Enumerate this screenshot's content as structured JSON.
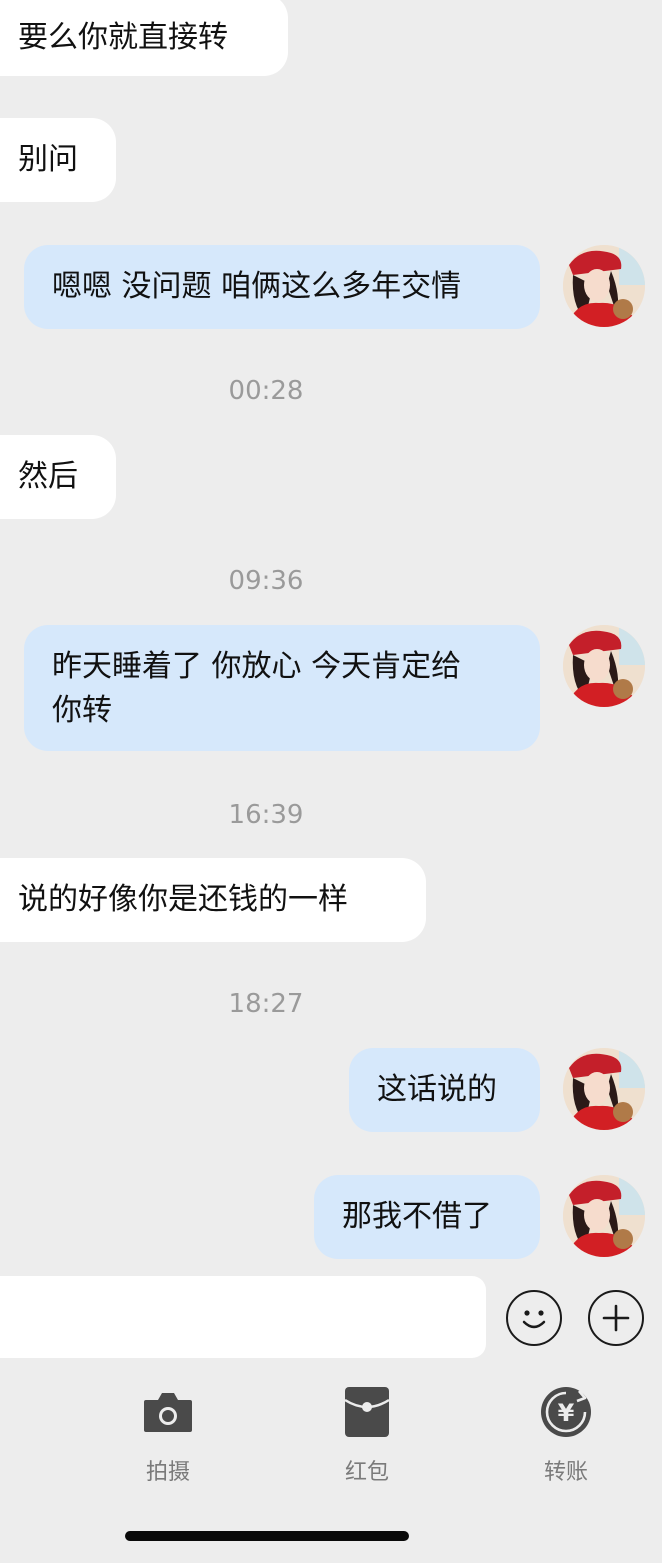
{
  "messages": [
    {
      "side": "left",
      "text": "要么你就直接转"
    },
    {
      "side": "left",
      "text": "别问"
    },
    {
      "side": "right",
      "text": "嗯嗯 没问题 咱俩这么多年交情"
    },
    {
      "type": "time",
      "text": "00:28"
    },
    {
      "side": "left",
      "text": "然后"
    },
    {
      "type": "time",
      "text": "09:36"
    },
    {
      "side": "right",
      "line1": "昨天睡着了 你放心 今天肯定给",
      "line2": "你转"
    },
    {
      "type": "time",
      "text": "16:39"
    },
    {
      "side": "left",
      "text": "说的好像你是还钱的一样"
    },
    {
      "type": "time",
      "text": "18:27"
    },
    {
      "side": "right",
      "text": "这话说的"
    },
    {
      "side": "right",
      "text": "那我不借了"
    }
  ],
  "input": {
    "placeholder": ""
  },
  "toolbar": {
    "camera": {
      "label": "拍摄",
      "icon": "camera-icon"
    },
    "red_packet": {
      "label": "红包",
      "icon": "red-packet-icon"
    },
    "transfer": {
      "label": "转账",
      "icon": "transfer-icon",
      "symbol": "¥"
    }
  },
  "colors": {
    "background": "#ededed",
    "incoming_bubble": "#ffffff",
    "outgoing_bubble": "#d6e8fb",
    "timestamp": "#9a9a9a"
  }
}
